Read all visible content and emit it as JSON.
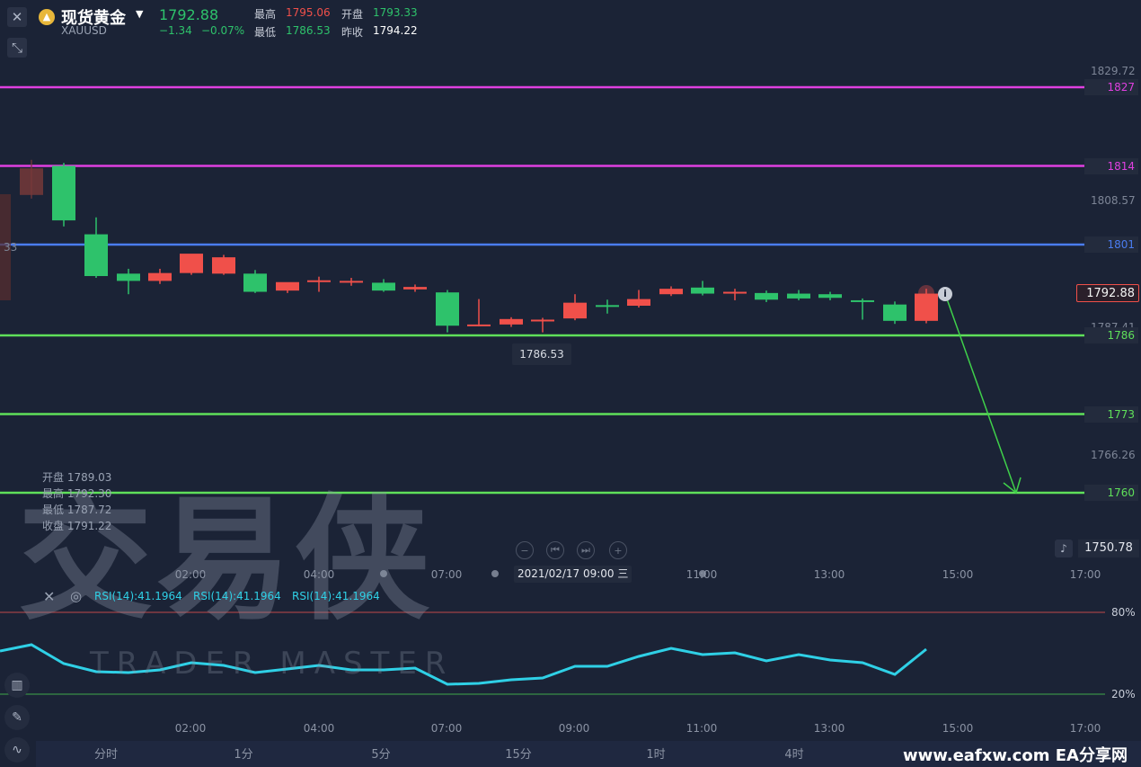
{
  "header": {
    "title": "现货黄金",
    "symbol": "XAUUSD",
    "last_price": "1792.88",
    "change": "−1.34",
    "change_pct": "−0.07%",
    "high_label": "最高",
    "high_value": "1795.06",
    "open_label": "开盘",
    "open_value": "1793.33",
    "low_label": "最低",
    "low_value": "1786.53",
    "prev_close_label": "昨收",
    "prev_close_value": "1794.22"
  },
  "price_axis": {
    "ticks": [
      "1829.72",
      "1808.57",
      "1787.41",
      "1766.26"
    ],
    "level_tags": [
      {
        "value": "1827",
        "color": "#e040e0"
      },
      {
        "value": "1814",
        "color": "#e040e0"
      },
      {
        "value": "1801",
        "color": "#4a7cf0"
      },
      {
        "value": "1786",
        "color": "#5fe05a"
      },
      {
        "value": "1773",
        "color": "#5fe05a"
      },
      {
        "value": "1760",
        "color": "#5fe05a"
      }
    ],
    "current_price": "1792.88",
    "alert_price": "1750.78",
    "left_partial": "33"
  },
  "low_marker": "1786.53",
  "ohlc_overlay": {
    "open": "开盘 1789.03",
    "high": "最高 1792.30",
    "low": "最低 1787.72",
    "close": "收盘 1791.22"
  },
  "time_axis": {
    "labels": [
      "02:00",
      "04:00",
      "07:00",
      "11:00",
      "13:00",
      "15:00",
      "17:00"
    ],
    "crosshair_time": "2021/02/17 09:00",
    "crosshair_day": "三"
  },
  "rsi": {
    "labels": [
      "RSI(14):41.1964",
      "RSI(14):41.1964",
      "RSI(14):41.1964"
    ],
    "upper": "80%",
    "lower": "20%",
    "time_labels": [
      "02:00",
      "04:00",
      "07:00",
      "09:00",
      "11:00",
      "13:00",
      "15:00",
      "17:00"
    ]
  },
  "tabs": [
    "分时",
    "1分",
    "5分",
    "15分",
    "1时",
    "4时"
  ],
  "watermark": {
    "main": "交易侠",
    "sub": "TRADER MASTER"
  },
  "footer_brand": "www.eafxw.com  EA分享网",
  "colors": {
    "up": "#2ec26b",
    "down": "#f0504a",
    "magenta": "#e040e0",
    "blue": "#4a7cf0",
    "lime": "#5fe05a",
    "rsi": "#2fd0e6"
  },
  "icons": [
    "close-icon",
    "collapse-icon",
    "gold-coin-icon",
    "dropdown-icon",
    "bell-icon",
    "indicator-icon",
    "draw-icon",
    "trend-icon",
    "settings-icon",
    "zoom-out-icon",
    "prev-icon",
    "next-icon",
    "zoom-in-icon",
    "info-icon"
  ]
}
